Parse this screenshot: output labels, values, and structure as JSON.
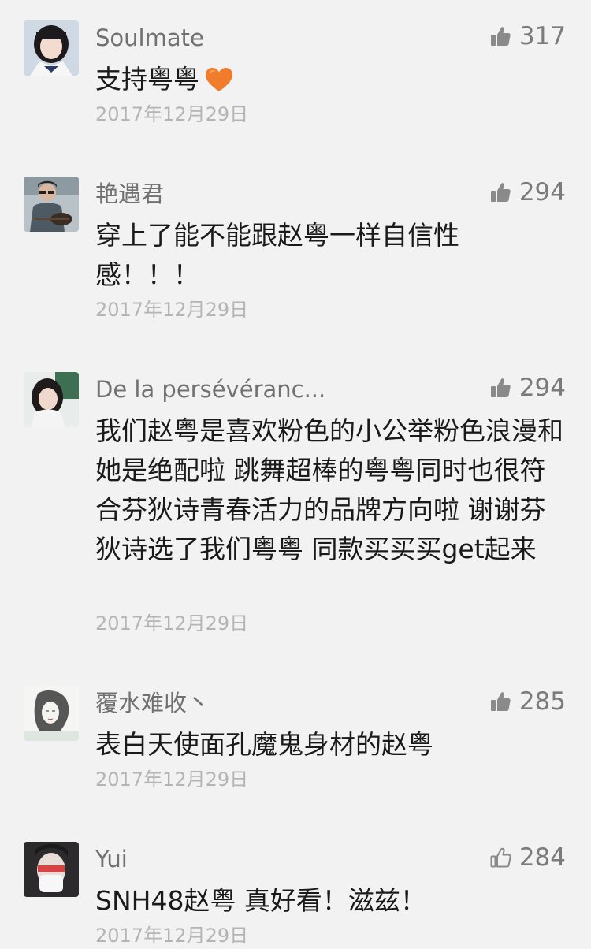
{
  "comments": [
    {
      "username": "Soulmate",
      "likes": "317",
      "text": "支持粤粤",
      "emoji": "orange-heart",
      "date": "2017年12月29日"
    },
    {
      "username": "艳遇君",
      "likes": "294",
      "text": "穿上了能不能跟赵粤一样自信性感！！！",
      "date": "2017年12月29日"
    },
    {
      "username": "De la persévéranc...",
      "likes": "294",
      "text": "我们赵粤是喜欢粉色的小公举粉色浪漫和她是绝配啦 跳舞超棒的粤粤同时也很符合芬狄诗青春活力的品牌方向啦 谢谢芬狄诗选了我们粤粤 同款买买买get起来",
      "date": "2017年12月29日"
    },
    {
      "username": "覆水难收丶",
      "likes": "285",
      "text": "表白天使面孔魔鬼身材的赵粤",
      "date": "2017年12月29日"
    },
    {
      "username": "Yui",
      "likes": "284",
      "text": "SNH48赵粤 真好看！滋兹！",
      "date": "2017年12月29日"
    }
  ],
  "colors": {
    "background": "#f2f2f2",
    "username": "#717171",
    "text": "#1a1a1a",
    "date": "#b4b4b4",
    "like_icon": "#8a8a8a"
  }
}
